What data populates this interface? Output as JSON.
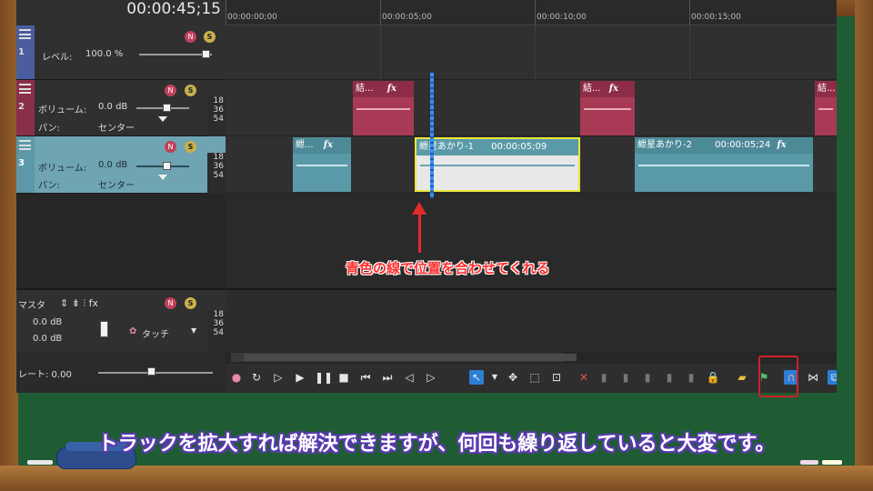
{
  "header": {
    "timecode": "00:00:45;15"
  },
  "ruler": {
    "ticks": [
      "00:00:00;00",
      "00:00:05;00",
      "00:00:10;00",
      "00:00:15;00"
    ]
  },
  "tracks": [
    {
      "number": "1",
      "param1_label": "レベル:",
      "param1_value": "100.0 %"
    },
    {
      "number": "2",
      "param1_label": "ボリューム:",
      "param1_value": "0.0 dB",
      "param2_label": "パン:",
      "param2_value": "センター"
    },
    {
      "number": "3",
      "param1_label": "ボリューム:",
      "param1_value": "0.0 dB",
      "param2_label": "パン:",
      "param2_value": "センター"
    }
  ],
  "scale_labels": [
    "18",
    "36",
    "54"
  ],
  "mute_icon_glyph": "N",
  "solo_icon_glyph": "S",
  "clips": {
    "track2": [
      "結...",
      "結...",
      "結..."
    ],
    "track3_small": "紲...",
    "track3_sel_name": "紲星あかり-1",
    "track3_sel_time": "00:00:05;09",
    "track3_second_name": "紲星あかり-2",
    "track3_second_time": "00:00:05;24"
  },
  "fx_label": "fx",
  "master": {
    "title": "マスタ",
    "vol1": "0.0 dB",
    "vol2": "0.0 dB",
    "touch_label": "タッチ"
  },
  "rate": {
    "label": "レート: 0.00"
  },
  "annotation": "青色の線で位置を合わせてくれる",
  "subtitle": "トラックを拡大すれば解決できますが、何回も繰り返していると大変です。",
  "colors": {
    "highlight": "#d0202a",
    "cursor_line": "#3a8ef0",
    "subtitle_outline": "#5a3ab0"
  }
}
